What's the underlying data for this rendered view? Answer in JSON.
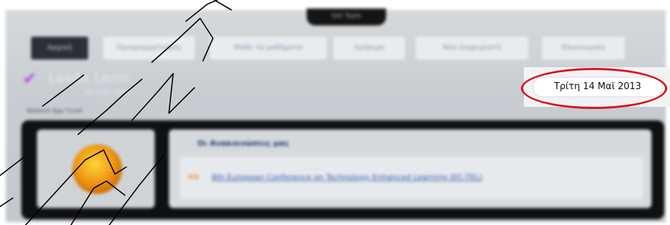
{
  "window": {
    "top_tab_label": "Get Toplo"
  },
  "nav": {
    "items": [
      {
        "label": "Αρχική",
        "active": true
      },
      {
        "label": "Προγραμματισμός",
        "active": false
      },
      {
        "label": "Μάθε τα μαθήματα",
        "active": false
      },
      {
        "label": "Χρήσιμα",
        "active": false
      },
      {
        "label": "Νέα διαχειριστή",
        "active": false
      },
      {
        "label": "Επικοινωνία",
        "active": false
      }
    ]
  },
  "logo": {
    "text": "Lasdo Lerin",
    "subtitle": "Be open Ideas"
  },
  "breadcrumb": "Network Αρχ Τοτοπ",
  "date": "Τρίτη 14 Μαϊ 2013",
  "news": {
    "title": "Οι Ανακοινώσεις μας",
    "items": [
      {
        "badge": "≡≡",
        "link": "8th European Conference on Technology Enhanced Learning (EC-TEL)"
      }
    ]
  },
  "colors": {
    "highlight": "#d9141c",
    "frame": "#0f1012",
    "logo_accent": "#b04bd4",
    "orb": "#f09a12"
  },
  "icons": {
    "logo": "checkmark-swoosh-icon",
    "orb": "globe-icon",
    "bullet": "new-badge-icon"
  },
  "watermark": "diagonal-hand-drawn-lines"
}
